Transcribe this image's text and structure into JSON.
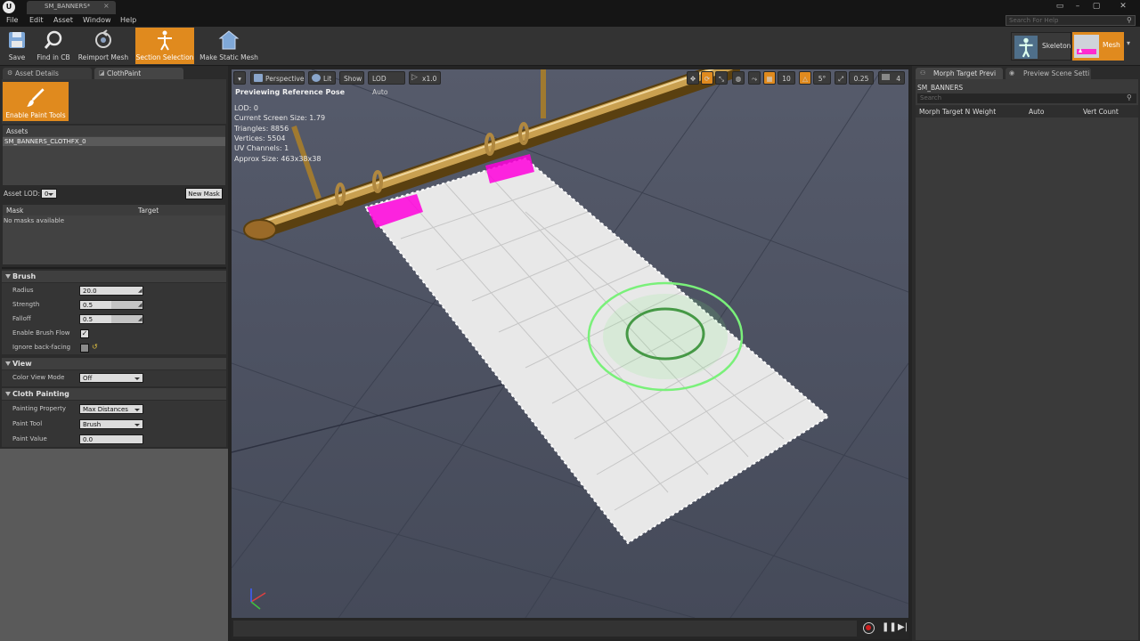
{
  "window": {
    "tab_title": "SM_BANNERS*",
    "search_placeholder": "Search For Help"
  },
  "menu": {
    "items": [
      "File",
      "Edit",
      "Asset",
      "Window",
      "Help"
    ]
  },
  "toolbar": {
    "buttons": [
      "Save",
      "Find in CB",
      "Reimport Mesh",
      "Section Selection",
      "Make Static Mesh"
    ],
    "active": "Section Selection",
    "modes": {
      "skeleton": "Skeleton",
      "mesh": "Mesh"
    }
  },
  "left_panel": {
    "tabs": [
      "Asset Details",
      "ClothPaint"
    ],
    "enable_paint_tools": "Enable Paint Tools",
    "assets_header": "Assets",
    "asset_item": "SM_BANNERS_CLOTHFX_0",
    "asset_lod_label": "Asset LOD:",
    "asset_lod_value": "0",
    "new_mask": "New Mask",
    "mask_col": "Mask",
    "target_col": "Target",
    "no_masks": "No masks available",
    "brush": {
      "header": "Brush",
      "radius_label": "Radius",
      "radius_value": "20.0",
      "strength_label": "Strength",
      "strength_value": "0.5",
      "falloff_label": "Falloff",
      "falloff_value": "0.5",
      "enable_flow_label": "Enable Brush Flow",
      "enable_flow_checked": true,
      "ignore_backfacing_label": "Ignore back-facing",
      "ignore_backfacing_checked": false
    },
    "view": {
      "header": "View",
      "color_view_mode_label": "Color View Mode",
      "color_view_mode_value": "Off"
    },
    "cloth_painting": {
      "header": "Cloth Painting",
      "painting_property_label": "Painting Property",
      "painting_property_value": "Max Distances",
      "paint_tool_label": "Paint Tool",
      "paint_tool_value": "Brush",
      "paint_value_label": "Paint Value",
      "paint_value_value": "0.0"
    }
  },
  "viewport": {
    "buttons": {
      "perspective": "Perspective",
      "lit": "Lit",
      "show": "Show",
      "lod": "LOD Auto",
      "speed": "x1.0"
    },
    "right_toggles": {
      "grid": "10",
      "angle": "5°",
      "scale": "0.25",
      "cam": "4"
    },
    "previewing": "Previewing Reference Pose",
    "stats": [
      "LOD: 0",
      "Current Screen Size: 1.79",
      "Triangles: 8856",
      "Vertices: 5504",
      "UV Channels: 1",
      "Approx Size: 463x38x38"
    ]
  },
  "right_panel": {
    "tabs": [
      "Morph Target Previ",
      "Preview Scene Setti"
    ],
    "asset_name": "SM_BANNERS",
    "search_placeholder": "Search",
    "columns": [
      "Morph Target N",
      "Weight",
      "Auto",
      "Vert Count"
    ]
  },
  "colors": {
    "accent_orange": "#e08a1e",
    "paint_magenta": "#ff00dc",
    "brush_green": "#7af07a"
  }
}
